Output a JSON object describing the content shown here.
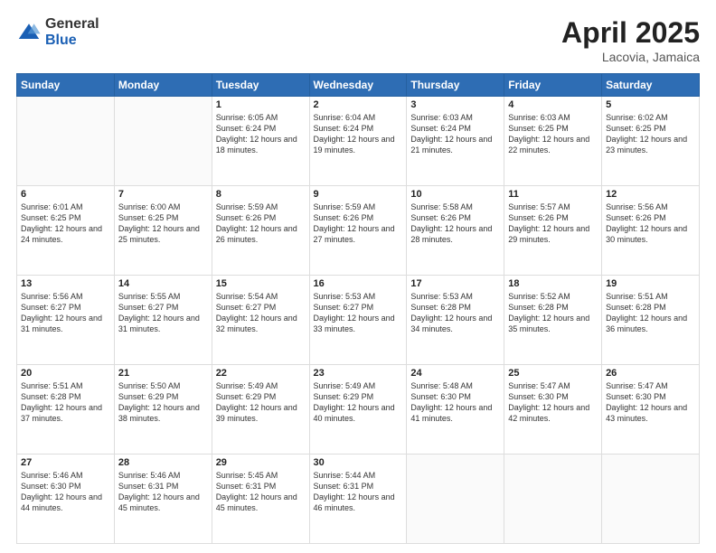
{
  "header": {
    "logo_general": "General",
    "logo_blue": "Blue",
    "title": "April 2025",
    "location": "Lacovia, Jamaica"
  },
  "weekdays": [
    "Sunday",
    "Monday",
    "Tuesday",
    "Wednesday",
    "Thursday",
    "Friday",
    "Saturday"
  ],
  "weeks": [
    [
      {
        "day": "",
        "info": ""
      },
      {
        "day": "",
        "info": ""
      },
      {
        "day": "1",
        "info": "Sunrise: 6:05 AM\nSunset: 6:24 PM\nDaylight: 12 hours and 18 minutes."
      },
      {
        "day": "2",
        "info": "Sunrise: 6:04 AM\nSunset: 6:24 PM\nDaylight: 12 hours and 19 minutes."
      },
      {
        "day": "3",
        "info": "Sunrise: 6:03 AM\nSunset: 6:24 PM\nDaylight: 12 hours and 21 minutes."
      },
      {
        "day": "4",
        "info": "Sunrise: 6:03 AM\nSunset: 6:25 PM\nDaylight: 12 hours and 22 minutes."
      },
      {
        "day": "5",
        "info": "Sunrise: 6:02 AM\nSunset: 6:25 PM\nDaylight: 12 hours and 23 minutes."
      }
    ],
    [
      {
        "day": "6",
        "info": "Sunrise: 6:01 AM\nSunset: 6:25 PM\nDaylight: 12 hours and 24 minutes."
      },
      {
        "day": "7",
        "info": "Sunrise: 6:00 AM\nSunset: 6:25 PM\nDaylight: 12 hours and 25 minutes."
      },
      {
        "day": "8",
        "info": "Sunrise: 5:59 AM\nSunset: 6:26 PM\nDaylight: 12 hours and 26 minutes."
      },
      {
        "day": "9",
        "info": "Sunrise: 5:59 AM\nSunset: 6:26 PM\nDaylight: 12 hours and 27 minutes."
      },
      {
        "day": "10",
        "info": "Sunrise: 5:58 AM\nSunset: 6:26 PM\nDaylight: 12 hours and 28 minutes."
      },
      {
        "day": "11",
        "info": "Sunrise: 5:57 AM\nSunset: 6:26 PM\nDaylight: 12 hours and 29 minutes."
      },
      {
        "day": "12",
        "info": "Sunrise: 5:56 AM\nSunset: 6:26 PM\nDaylight: 12 hours and 30 minutes."
      }
    ],
    [
      {
        "day": "13",
        "info": "Sunrise: 5:56 AM\nSunset: 6:27 PM\nDaylight: 12 hours and 31 minutes."
      },
      {
        "day": "14",
        "info": "Sunrise: 5:55 AM\nSunset: 6:27 PM\nDaylight: 12 hours and 31 minutes."
      },
      {
        "day": "15",
        "info": "Sunrise: 5:54 AM\nSunset: 6:27 PM\nDaylight: 12 hours and 32 minutes."
      },
      {
        "day": "16",
        "info": "Sunrise: 5:53 AM\nSunset: 6:27 PM\nDaylight: 12 hours and 33 minutes."
      },
      {
        "day": "17",
        "info": "Sunrise: 5:53 AM\nSunset: 6:28 PM\nDaylight: 12 hours and 34 minutes."
      },
      {
        "day": "18",
        "info": "Sunrise: 5:52 AM\nSunset: 6:28 PM\nDaylight: 12 hours and 35 minutes."
      },
      {
        "day": "19",
        "info": "Sunrise: 5:51 AM\nSunset: 6:28 PM\nDaylight: 12 hours and 36 minutes."
      }
    ],
    [
      {
        "day": "20",
        "info": "Sunrise: 5:51 AM\nSunset: 6:28 PM\nDaylight: 12 hours and 37 minutes."
      },
      {
        "day": "21",
        "info": "Sunrise: 5:50 AM\nSunset: 6:29 PM\nDaylight: 12 hours and 38 minutes."
      },
      {
        "day": "22",
        "info": "Sunrise: 5:49 AM\nSunset: 6:29 PM\nDaylight: 12 hours and 39 minutes."
      },
      {
        "day": "23",
        "info": "Sunrise: 5:49 AM\nSunset: 6:29 PM\nDaylight: 12 hours and 40 minutes."
      },
      {
        "day": "24",
        "info": "Sunrise: 5:48 AM\nSunset: 6:30 PM\nDaylight: 12 hours and 41 minutes."
      },
      {
        "day": "25",
        "info": "Sunrise: 5:47 AM\nSunset: 6:30 PM\nDaylight: 12 hours and 42 minutes."
      },
      {
        "day": "26",
        "info": "Sunrise: 5:47 AM\nSunset: 6:30 PM\nDaylight: 12 hours and 43 minutes."
      }
    ],
    [
      {
        "day": "27",
        "info": "Sunrise: 5:46 AM\nSunset: 6:30 PM\nDaylight: 12 hours and 44 minutes."
      },
      {
        "day": "28",
        "info": "Sunrise: 5:46 AM\nSunset: 6:31 PM\nDaylight: 12 hours and 45 minutes."
      },
      {
        "day": "29",
        "info": "Sunrise: 5:45 AM\nSunset: 6:31 PM\nDaylight: 12 hours and 45 minutes."
      },
      {
        "day": "30",
        "info": "Sunrise: 5:44 AM\nSunset: 6:31 PM\nDaylight: 12 hours and 46 minutes."
      },
      {
        "day": "",
        "info": ""
      },
      {
        "day": "",
        "info": ""
      },
      {
        "day": "",
        "info": ""
      }
    ]
  ]
}
